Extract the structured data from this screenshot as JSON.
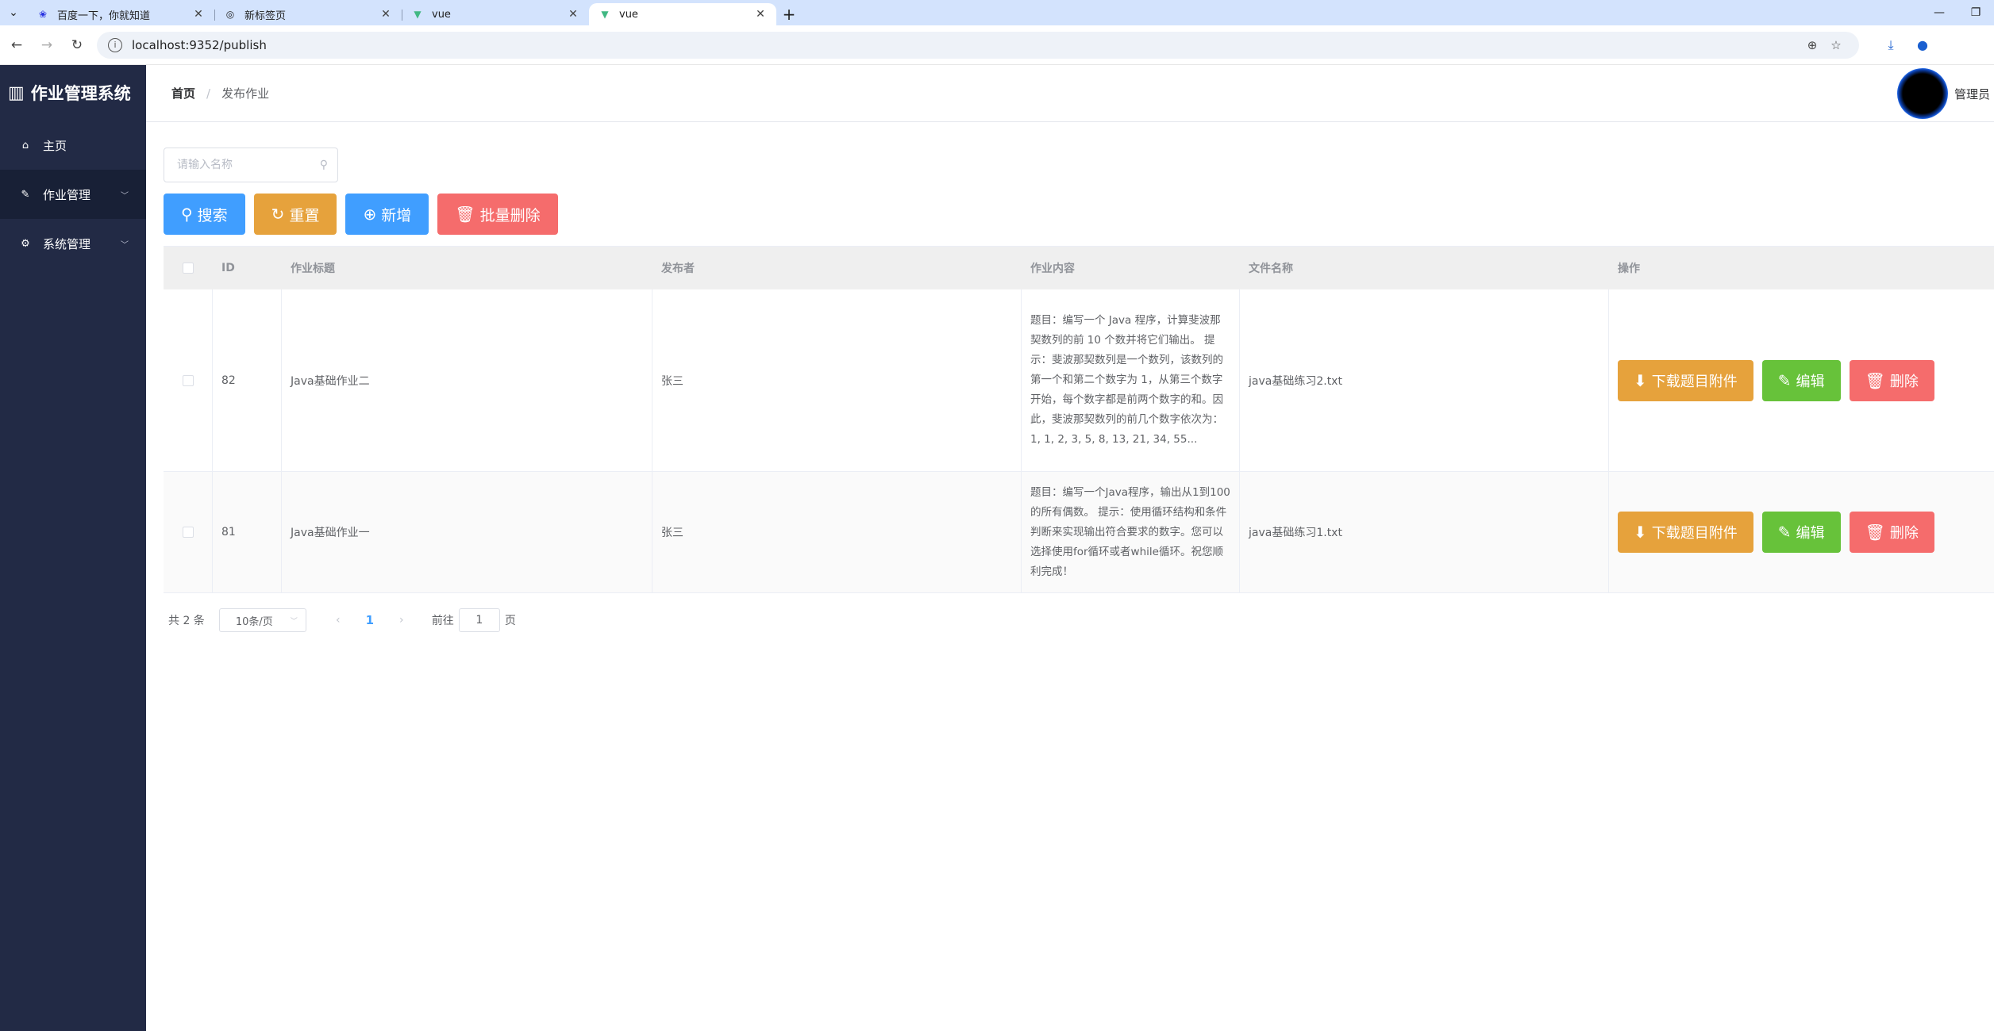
{
  "browser": {
    "tabs": [
      {
        "title": "百度一下，你就知道",
        "icon": "baidu-paw-icon",
        "active": false
      },
      {
        "title": "新标签页",
        "icon": "chrome-icon",
        "active": false
      },
      {
        "title": "vue",
        "icon": "vue-logo-icon",
        "active": false
      },
      {
        "title": "vue",
        "icon": "vue-logo-icon",
        "active": true
      }
    ],
    "url": "localhost:9352/publish"
  },
  "sidebar": {
    "brand": "作业管理系统",
    "items": [
      {
        "label": "主页",
        "icon": "home-icon"
      },
      {
        "label": "作业管理",
        "icon": "edit-icon"
      },
      {
        "label": "系统管理",
        "icon": "gear-icon"
      }
    ]
  },
  "header": {
    "breadcrumb_home": "首页",
    "breadcrumb_separator": "/",
    "breadcrumb_current": "发布作业",
    "username": "管理员"
  },
  "search": {
    "placeholder": "请输入名称"
  },
  "actions": {
    "search": "搜索",
    "reset": "重置",
    "add": "新增",
    "batch_delete": "批量删除"
  },
  "table": {
    "columns": {
      "id": "ID",
      "title": "作业标题",
      "publisher": "发布者",
      "content": "作业内容",
      "file": "文件名称",
      "ops": "操作"
    },
    "rows": [
      {
        "id": "82",
        "title": "Java基础作业二",
        "publisher": "张三",
        "content": "题目：编写一个 Java 程序，计算斐波那契数列的前 10 个数并将它们输出。 提示：斐波那契数列是一个数列，该数列的第一个和第二个数字为 1，从第三个数字开始，每个数字都是前两个数字的和。因此，斐波那契数列的前几个数字依次为：1, 1, 2, 3, 5, 8, 13, 21, 34, 55...",
        "file": "java基础练习2.txt"
      },
      {
        "id": "81",
        "title": "Java基础作业一",
        "publisher": "张三",
        "content": "题目：编写一个Java程序，输出从1到100的所有偶数。 提示：使用循环结构和条件判断来实现输出符合要求的数字。您可以选择使用for循环或者while循环。祝您顺利完成！",
        "file": "java基础练习1.txt"
      }
    ],
    "row_actions": {
      "download": "下载题目附件",
      "edit": "编辑",
      "delete": "删除"
    }
  },
  "pagination": {
    "total": "共 2 条",
    "page_size": "10条/页",
    "current_page": "1",
    "goto_prefix": "前往",
    "goto_value": "1",
    "goto_suffix": "页"
  },
  "colors": {
    "sidebar_bg": "#222a45",
    "primary": "#409eff",
    "warning": "#e6a23c",
    "danger": "#f56c6c",
    "success": "#67c23a"
  }
}
